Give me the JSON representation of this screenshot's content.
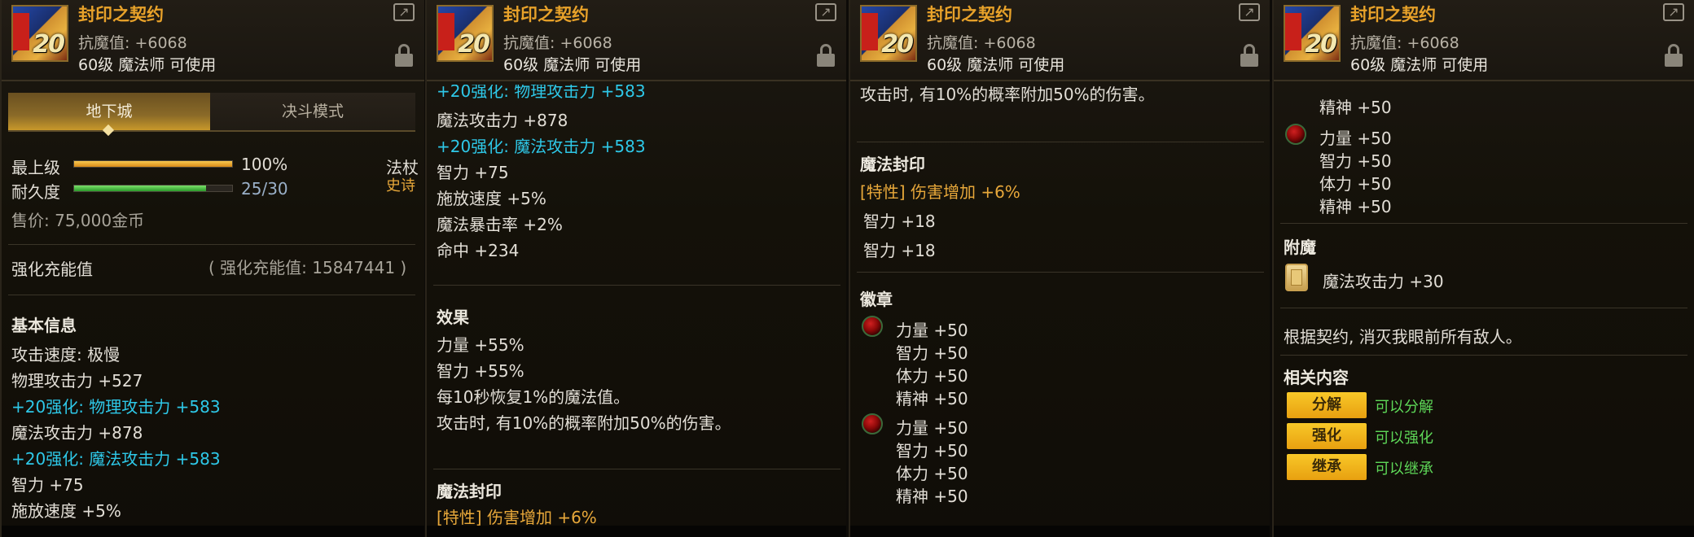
{
  "item": {
    "name": "封印之契约",
    "anti_magic": "抗魔值: +6068",
    "usable": "60级 魔法师 可使用",
    "icon_level": "20"
  },
  "panel1": {
    "tabs": [
      "地下城",
      "决斗模式"
    ],
    "grade_label": "最上级",
    "grade_value": "100%",
    "grade_fraction": 1.0,
    "weapon_type": "法杖",
    "durability_label": "耐久度",
    "durability_value": "25/30",
    "durability_fraction": 0.8333,
    "rarity": "史诗",
    "price": "售价: 75,000金币",
    "charge_label": "强化充能值",
    "charge_value": "( 强化充能值: 15847441 )",
    "basic_title": "基本信息",
    "lines": [
      "攻击速度: 极慢",
      "物理攻击力 +527",
      "+20强化: 物理攻击力 +583",
      "魔法攻击力 +878",
      "+20强化: 魔法攻击力 +583",
      "智力 +75",
      "施放速度 +5%"
    ]
  },
  "panel2": {
    "lines": [
      "+20强化: 物理攻击力 +583",
      "魔法攻击力 +878",
      "+20强化: 魔法攻击力 +583",
      "智力 +75",
      "施放速度 +5%",
      "魔法暴击率 +2%",
      "命中 +234"
    ],
    "effect_title": "效果",
    "effect_lines": [
      "力量 +55%",
      "智力 +55%",
      "每10秒恢复1%的魔法值。",
      "攻击时, 有10%的概率附加50%的伤害。"
    ],
    "seal_title": "魔法封印",
    "seal_first": "[特性] 伤害增加 +6%"
  },
  "panel3": {
    "top_line": "攻击时, 有10%的概率附加50%的伤害。",
    "seal_title": "魔法封印",
    "seal_lines": [
      "[特性] 伤害增加 +6%",
      "智力 +18",
      "智力 +18"
    ],
    "emblem_title": "徽章",
    "emblem1": [
      "力量 +50",
      "智力 +50",
      "体力 +50",
      "精神 +50"
    ],
    "emblem2": [
      "力量 +50",
      "智力 +50",
      "体力 +50",
      "精神 +50"
    ]
  },
  "panel4": {
    "cut_top": "精神 +50",
    "emblem_top": [
      "精神 +50"
    ],
    "emblem": [
      "力量 +50",
      "智力 +50",
      "体力 +50",
      "精神 +50"
    ],
    "enchant_title": "附魔",
    "enchant_value": "魔法攻击力 +30",
    "flavor": "根据契约, 消灭我眼前所有敌人。",
    "related_title": "相关内容",
    "related": [
      {
        "button": "分解",
        "status": "可以分解"
      },
      {
        "button": "强化",
        "status": "可以强化"
      },
      {
        "button": "继承",
        "status": "可以继承"
      }
    ]
  }
}
